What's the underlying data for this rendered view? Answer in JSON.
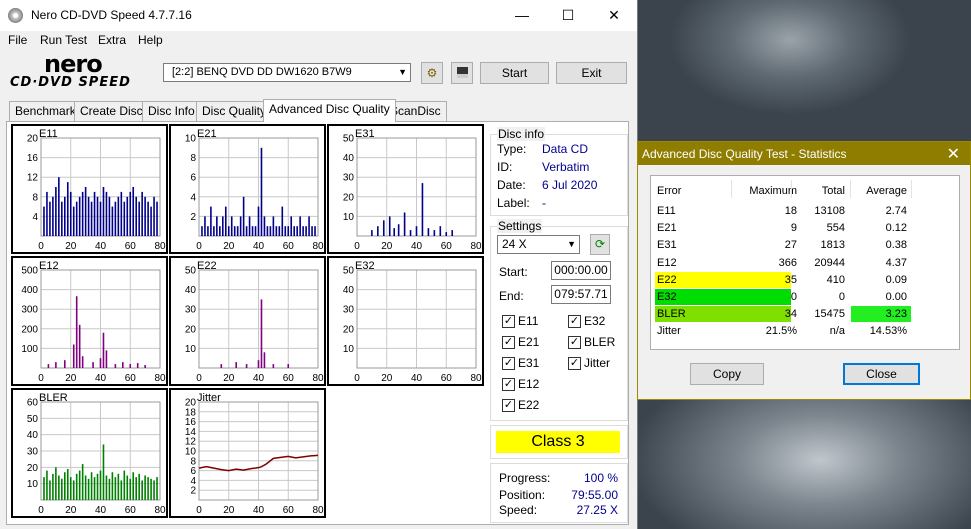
{
  "window": {
    "title": "Nero CD-DVD Speed 4.7.7.16",
    "minimize": "—",
    "maximize": "☐",
    "close": "✕"
  },
  "menu": [
    "File",
    "Run Test",
    "Extra",
    "Help"
  ],
  "logo": {
    "line1": "nero",
    "line2": "CD·DVD SPEED"
  },
  "toolbar": {
    "drive": "[2:2]   BENQ DVD DD DW1620 B7W9",
    "start": "Start",
    "exit": "Exit"
  },
  "tabs": [
    "Benchmark",
    "Create Disc",
    "Disc Info",
    "Disc Quality",
    "Advanced Disc Quality",
    "ScanDisc"
  ],
  "active_tab": "Advanced Disc Quality",
  "disc_info": {
    "title": "Disc info",
    "type_label": "Type:",
    "type": "Data CD",
    "id_label": "ID:",
    "id": "Verbatim",
    "date_label": "Date:",
    "date": "6 Jul 2020",
    "label_label": "Label:",
    "label": "-"
  },
  "settings": {
    "title": "Settings",
    "speed": "24 X",
    "start_label": "Start:",
    "start": "000:00.00",
    "end_label": "End:",
    "end": "079:57.71",
    "checks": [
      "E11",
      "E32",
      "E21",
      "BLER",
      "E31",
      "Jitter",
      "E12",
      "E22"
    ]
  },
  "class_label": "Class 3",
  "progress": {
    "progress_label": "Progress:",
    "progress": "100 %",
    "position_label": "Position:",
    "position": "79:55.00",
    "speed_label": "Speed:",
    "speed": "27.25 X"
  },
  "chart_data": [
    {
      "name": "E11",
      "type": "bar",
      "ylim": [
        0,
        20
      ],
      "yticks": [
        4,
        8,
        12,
        16,
        20
      ],
      "xlim": [
        0,
        80
      ],
      "xticks": [
        0,
        20,
        40,
        60,
        80
      ],
      "color": "#00008b",
      "x": [
        2,
        4,
        6,
        8,
        10,
        12,
        14,
        16,
        18,
        20,
        22,
        24,
        26,
        28,
        30,
        32,
        34,
        36,
        38,
        40,
        42,
        44,
        46,
        48,
        50,
        52,
        54,
        56,
        58,
        60,
        62,
        64,
        66,
        68,
        70,
        72,
        74,
        76,
        78
      ],
      "values": [
        6,
        9,
        7,
        8,
        10,
        12,
        7,
        8,
        11,
        9,
        6,
        7,
        8,
        9,
        10,
        8,
        7,
        9,
        8,
        7,
        10,
        9,
        8,
        6,
        7,
        8,
        9,
        7,
        8,
        9,
        10,
        8,
        7,
        9,
        8,
        7,
        6,
        8,
        7
      ]
    },
    {
      "name": "E21",
      "type": "bar",
      "ylim": [
        0,
        10
      ],
      "yticks": [
        2,
        4,
        6,
        8,
        10
      ],
      "xlim": [
        0,
        80
      ],
      "xticks": [
        0,
        20,
        40,
        60,
        80
      ],
      "color": "#00008b",
      "x": [
        2,
        4,
        6,
        8,
        10,
        12,
        14,
        16,
        18,
        20,
        22,
        24,
        26,
        28,
        30,
        32,
        34,
        36,
        38,
        40,
        42,
        44,
        46,
        48,
        50,
        52,
        54,
        56,
        58,
        60,
        62,
        64,
        66,
        68,
        70,
        72,
        74,
        76,
        78
      ],
      "values": [
        1,
        2,
        1,
        3,
        1,
        2,
        1,
        2,
        3,
        1,
        2,
        1,
        1,
        2,
        4,
        1,
        2,
        1,
        1,
        3,
        9,
        2,
        1,
        1,
        2,
        1,
        1,
        3,
        1,
        1,
        2,
        1,
        1,
        2,
        1,
        1,
        2,
        1,
        1
      ]
    },
    {
      "name": "E31",
      "type": "bar",
      "ylim": [
        0,
        50
      ],
      "yticks": [
        10,
        20,
        30,
        40,
        50
      ],
      "xlim": [
        0,
        80
      ],
      "xticks": [
        0,
        20,
        40,
        60,
        80
      ],
      "color": "#00008b",
      "x": [
        10,
        14,
        18,
        22,
        25,
        28,
        32,
        36,
        40,
        44,
        48,
        52,
        56,
        60,
        64
      ],
      "values": [
        3,
        5,
        8,
        10,
        4,
        6,
        12,
        3,
        5,
        27,
        4,
        3,
        5,
        2,
        3
      ]
    },
    {
      "name": "E12",
      "type": "bar",
      "ylim": [
        0,
        500
      ],
      "yticks": [
        100,
        200,
        300,
        400,
        500
      ],
      "xlim": [
        0,
        80
      ],
      "xticks": [
        0,
        20,
        40,
        60,
        80
      ],
      "color": "#800080",
      "x": [
        5,
        10,
        16,
        22,
        24,
        26,
        28,
        35,
        40,
        42,
        44,
        50,
        55,
        60,
        65,
        70
      ],
      "values": [
        20,
        30,
        40,
        120,
        366,
        220,
        60,
        30,
        50,
        180,
        90,
        20,
        30,
        20,
        25,
        15
      ]
    },
    {
      "name": "E22",
      "type": "bar",
      "ylim": [
        0,
        50
      ],
      "yticks": [
        10,
        20,
        30,
        40,
        50
      ],
      "xlim": [
        0,
        80
      ],
      "xticks": [
        0,
        20,
        40,
        60,
        80
      ],
      "color": "#800080",
      "x": [
        15,
        25,
        32,
        40,
        42,
        44,
        50,
        60
      ],
      "values": [
        2,
        3,
        2,
        4,
        35,
        8,
        2,
        2
      ]
    },
    {
      "name": "E32",
      "type": "bar",
      "ylim": [
        0,
        50
      ],
      "yticks": [
        10,
        20,
        30,
        40,
        50
      ],
      "xlim": [
        0,
        80
      ],
      "xticks": [
        0,
        20,
        40,
        60,
        80
      ],
      "color": "#800080",
      "x": [],
      "values": []
    },
    {
      "name": "BLER",
      "type": "bar",
      "ylim": [
        0,
        60
      ],
      "yticks": [
        10,
        20,
        30,
        40,
        50,
        60
      ],
      "xlim": [
        0,
        80
      ],
      "xticks": [
        0,
        20,
        40,
        60,
        80
      ],
      "color": "#008000",
      "x": [
        2,
        4,
        6,
        8,
        10,
        12,
        14,
        16,
        18,
        20,
        22,
        24,
        26,
        28,
        30,
        32,
        34,
        36,
        38,
        40,
        42,
        44,
        46,
        48,
        50,
        52,
        54,
        56,
        58,
        60,
        62,
        64,
        66,
        68,
        70,
        72,
        74,
        76,
        78
      ],
      "values": [
        14,
        18,
        12,
        16,
        20,
        15,
        13,
        17,
        19,
        14,
        12,
        16,
        18,
        22,
        15,
        13,
        17,
        14,
        16,
        18,
        34,
        15,
        13,
        17,
        14,
        16,
        12,
        18,
        15,
        13,
        17,
        14,
        16,
        12,
        15,
        14,
        13,
        12,
        14
      ]
    },
    {
      "name": "Jitter",
      "type": "line",
      "ylim": [
        0,
        20
      ],
      "yticks": [
        2,
        4,
        6,
        8,
        10,
        12,
        14,
        16,
        18,
        20
      ],
      "xlim": [
        0,
        80
      ],
      "xticks": [
        0,
        20,
        40,
        60,
        80
      ],
      "color": "#800000",
      "x": [
        0,
        5,
        10,
        15,
        20,
        25,
        30,
        35,
        40,
        42,
        45,
        50,
        55,
        60,
        65,
        70,
        75,
        80
      ],
      "values": [
        6.5,
        6.8,
        6.5,
        6.2,
        6.0,
        6.3,
        6.1,
        6.4,
        6.6,
        6.8,
        7.3,
        8.5,
        8.7,
        8.9,
        8.6,
        8.8,
        9.0,
        9.1
      ]
    }
  ],
  "stats": {
    "title": "Advanced Disc Quality Test - Statistics",
    "headers": [
      "Error",
      "Maximum",
      "Total",
      "Average"
    ],
    "rows": [
      {
        "error": "E11",
        "maximum": "18",
        "total": "13108",
        "average": "2.74",
        "hl": "",
        "avg_hl": ""
      },
      {
        "error": "E21",
        "maximum": "9",
        "total": "554",
        "average": "0.12",
        "hl": "",
        "avg_hl": ""
      },
      {
        "error": "E31",
        "maximum": "27",
        "total": "1813",
        "average": "0.38",
        "hl": "",
        "avg_hl": ""
      },
      {
        "error": "E12",
        "maximum": "366",
        "total": "20944",
        "average": "4.37",
        "hl": "",
        "avg_hl": ""
      },
      {
        "error": "E22",
        "maximum": "35",
        "total": "410",
        "average": "0.09",
        "hl": "#ffff00",
        "avg_hl": ""
      },
      {
        "error": "E32",
        "maximum": "0",
        "total": "0",
        "average": "0.00",
        "hl": "#00dd00",
        "avg_hl": ""
      },
      {
        "error": "BLER",
        "maximum": "34",
        "total": "15475",
        "average": "3.23",
        "hl": "#7fe000",
        "avg_hl": "#22ee22"
      },
      {
        "error": "Jitter",
        "maximum": "21.5%",
        "total": "n/a",
        "average": "14.53%",
        "hl": "",
        "avg_hl": ""
      }
    ],
    "copy": "Copy",
    "close": "Close"
  }
}
